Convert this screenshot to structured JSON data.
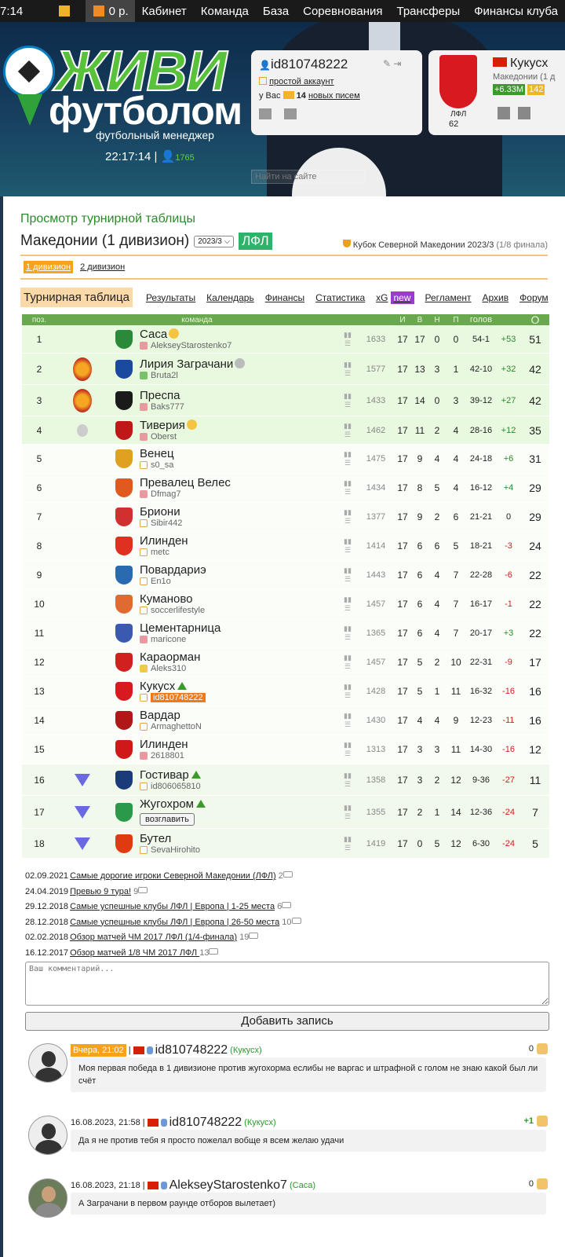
{
  "topbar": {
    "clock": "7:14",
    "money": "0 р.",
    "nav": [
      "Кабинет",
      "Команда",
      "База",
      "Соревнования",
      "Трансферы",
      "Финансы клуба"
    ]
  },
  "header": {
    "logo_line1": "ЖИВИ",
    "logo_line2": "футболом",
    "logo_sub": "футбольный менеджер",
    "server_time": "22:17:14",
    "online": "1765",
    "search_placeholder": "Найти на сайте"
  },
  "user": {
    "id": "id810748222",
    "account_type": "простой аккаунт",
    "mail_prefix": "у Вас",
    "mail_count": "14",
    "mail_label": "новых писем"
  },
  "club": {
    "name": "Кукусх",
    "division": "Македонии (1 д",
    "money": "+6.33М",
    "coins": "142",
    "league_short": "ЛФЛ",
    "rating": "62"
  },
  "page": {
    "title": "Просмотр турнирной таблицы",
    "league": "Македонии (1 дивизион)",
    "season": "2023/3",
    "badge": "ЛФЛ",
    "cup": "Кубок Северной Македонии 2023/3",
    "cup_stage": "(1/8 финала)",
    "div_tabs": [
      "1 дивизион",
      "2 дивизион"
    ],
    "sub_tabs": [
      "Турнирная таблица",
      "Результаты",
      "Календарь",
      "Финансы",
      "Статистика",
      "xG",
      "Регламент",
      "Архив",
      "Форум"
    ],
    "new_label": "new"
  },
  "table": {
    "headers": [
      "поз.",
      "команда",
      "И",
      "В",
      "Н",
      "П",
      "голов",
      "О"
    ],
    "return_button": "возглавить",
    "rows": [
      {
        "pos": "1",
        "team": "Саса",
        "manager": "AlekseyStarostenko7",
        "rating": "1633",
        "p": "17",
        "w": "17",
        "d": "0",
        "l": "0",
        "goals": "54-1",
        "diff": "+53",
        "pts": "51"
      },
      {
        "pos": "2",
        "team": "Лирия Заграчани",
        "manager": "Bruta2l",
        "rating": "1577",
        "p": "17",
        "w": "13",
        "d": "3",
        "l": "1",
        "goals": "42-10",
        "diff": "+32",
        "pts": "42"
      },
      {
        "pos": "3",
        "team": "Преспа",
        "manager": "Baks777",
        "rating": "1433",
        "p": "17",
        "w": "14",
        "d": "0",
        "l": "3",
        "goals": "39-12",
        "diff": "+27",
        "pts": "42"
      },
      {
        "pos": "4",
        "team": "Тиверия",
        "manager": "Oberst",
        "rating": "1462",
        "p": "17",
        "w": "11",
        "d": "2",
        "l": "4",
        "goals": "28-16",
        "diff": "+12",
        "pts": "35"
      },
      {
        "pos": "5",
        "team": "Венец",
        "manager": "s0_sa",
        "rating": "1475",
        "p": "17",
        "w": "9",
        "d": "4",
        "l": "4",
        "goals": "24-18",
        "diff": "+6",
        "pts": "31"
      },
      {
        "pos": "6",
        "team": "Превалец Велес",
        "manager": "Dfmag7",
        "rating": "1434",
        "p": "17",
        "w": "8",
        "d": "5",
        "l": "4",
        "goals": "16-12",
        "diff": "+4",
        "pts": "29"
      },
      {
        "pos": "7",
        "team": "Бриони",
        "manager": "Sibir442",
        "rating": "1377",
        "p": "17",
        "w": "9",
        "d": "2",
        "l": "6",
        "goals": "21-21",
        "diff": "0",
        "pts": "29"
      },
      {
        "pos": "8",
        "team": "Илинден",
        "manager": "metc",
        "rating": "1414",
        "p": "17",
        "w": "6",
        "d": "6",
        "l": "5",
        "goals": "18-21",
        "diff": "-3",
        "pts": "24"
      },
      {
        "pos": "9",
        "team": "Повардариэ",
        "manager": "En1o",
        "rating": "1443",
        "p": "17",
        "w": "6",
        "d": "4",
        "l": "7",
        "goals": "22-28",
        "diff": "-6",
        "pts": "22"
      },
      {
        "pos": "10",
        "team": "Куманово",
        "manager": "soccerlifestyle",
        "rating": "1457",
        "p": "17",
        "w": "6",
        "d": "4",
        "l": "7",
        "goals": "16-17",
        "diff": "-1",
        "pts": "22"
      },
      {
        "pos": "11",
        "team": "Цементарница",
        "manager": "maricone",
        "rating": "1365",
        "p": "17",
        "w": "6",
        "d": "4",
        "l": "7",
        "goals": "20-17",
        "diff": "+3",
        "pts": "22"
      },
      {
        "pos": "12",
        "team": "Караорман",
        "manager": "Aleks310",
        "rating": "1457",
        "p": "17",
        "w": "5",
        "d": "2",
        "l": "10",
        "goals": "22-31",
        "diff": "-9",
        "pts": "17"
      },
      {
        "pos": "13",
        "team": "Кукусх",
        "manager": "id810748222",
        "rating": "1428",
        "p": "17",
        "w": "5",
        "d": "1",
        "l": "11",
        "goals": "16-32",
        "diff": "-16",
        "pts": "16"
      },
      {
        "pos": "14",
        "team": "Вардар",
        "manager": "ArmaghettoN",
        "rating": "1430",
        "p": "17",
        "w": "4",
        "d": "4",
        "l": "9",
        "goals": "12-23",
        "diff": "-11",
        "pts": "16"
      },
      {
        "pos": "15",
        "team": "Илинден",
        "manager": "2618801",
        "rating": "1313",
        "p": "17",
        "w": "3",
        "d": "3",
        "l": "11",
        "goals": "14-30",
        "diff": "-16",
        "pts": "12"
      },
      {
        "pos": "16",
        "team": "Гостивар",
        "manager": "id806065810",
        "rating": "1358",
        "p": "17",
        "w": "3",
        "d": "2",
        "l": "12",
        "goals": "9-36",
        "diff": "-27",
        "pts": "11"
      },
      {
        "pos": "17",
        "team": "Жугохром",
        "manager": "",
        "rating": "1355",
        "p": "17",
        "w": "2",
        "d": "1",
        "l": "14",
        "goals": "12-36",
        "diff": "-24",
        "pts": "7"
      },
      {
        "pos": "18",
        "team": "Бутел",
        "manager": "SevaHirohito",
        "rating": "1419",
        "p": "17",
        "w": "0",
        "d": "5",
        "l": "12",
        "goals": "6-30",
        "diff": "-24",
        "pts": "5"
      }
    ]
  },
  "news": [
    {
      "date": "02.09.2021",
      "title": "Самые дорогие игроки Северной Македонии (ЛФЛ)",
      "count": "2"
    },
    {
      "date": "24.04.2019",
      "title": "Превью 9 тура!",
      "count": "9"
    },
    {
      "date": "29.12.2018",
      "title": "Самые успешные клубы ЛФЛ | Европа | 1-25 места",
      "count": "6"
    },
    {
      "date": "28.12.2018",
      "title": "Самые успешные клубы ЛФЛ | Европа | 26-50 места",
      "count": "10"
    },
    {
      "date": "02.02.2018",
      "title": "Обзор матчей ЧМ 2017 ЛФЛ (1/4-финала)",
      "count": "19"
    },
    {
      "date": "16.12.2017",
      "title": "Обзор матчей 1/8 ЧМ 2017 ЛФЛ ",
      "count": "13"
    }
  ],
  "comment_form": {
    "placeholder": "Ваш комментарий...",
    "submit": "Добавить запись"
  },
  "comments": [
    {
      "time": "Вчера, 21:02",
      "user": "id810748222",
      "club": "(Кукусх)",
      "likes": "0",
      "text": "Моя первая победа в 1 дивизионе против жугохорма еслибы не варгас и штрафной с голом не знаю какой был ли счёт"
    },
    {
      "time": "16.08.2023, 21:58",
      "user": "id810748222",
      "club": "(Кукусх)",
      "likes": "+1",
      "text": "Да я не против тебя я просто пожелал вобще я всем желаю удачи"
    },
    {
      "time": "16.08.2023, 21:18",
      "user": "AlekseyStarostenko7",
      "club": "(Саса)",
      "likes": "0",
      "text": "А Заграчани в первом раунде отборов вылетает)"
    }
  ]
}
